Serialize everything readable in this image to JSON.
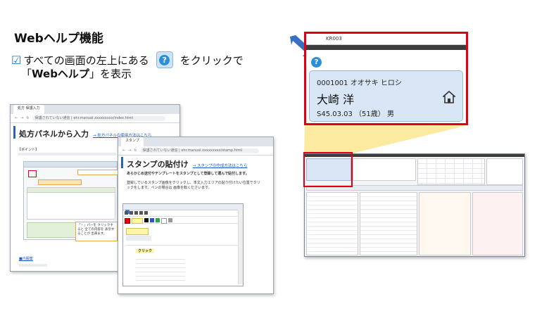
{
  "heading": "Webヘルプ機能",
  "instruction": {
    "checkbox_glyph": "☑",
    "before_icon": "すべての画面の左上にある",
    "help_icon": "question-circle-icon",
    "after_icon": "をクリックで",
    "line2_open": "「",
    "line2_bold": "Webヘルプ",
    "line2_close": "」を表示"
  },
  "browser_back": {
    "tab_label": "処方 保護入力",
    "address": "保護されていない通信 | ehr.manual.xxxxxxxxx/index.html",
    "page_title": "処方パネルから入力",
    "page_link": "→ 処方パネルの使用方法はこちら",
    "point_label": "【ポイント】",
    "callout_text": "「・」パーを クリックすると 全ての内容を 表示することが 出来ます。",
    "footer_link": "■内服薬"
  },
  "browser_front": {
    "tab_label": "スタンプ",
    "address": "保護されていない通信 | ehr.manual.xxxxxxxxx/stamp.html",
    "page_title": "スタンプの貼付け",
    "page_link": "→ スタンプの作成方法はこちら",
    "subtitle": "あらかじめ送付やテンプレートをスタンプとして登録して選んで貼付します。",
    "body_text": "登録しているスタンプ画像をクリックし、本文入力エリアの貼り付けたい位置でクリックをします。ペンの場合は 画像を転くださいます。",
    "click_label": "クリック"
  },
  "zoom_panel": {
    "header_label": "KR003",
    "help_icon": "question-circle-icon",
    "patient_id_kana": "0001001 オオサキ ヒロシ",
    "patient_name": "大崎 洋",
    "patient_dob": "S45.03.03 （51歳） 男",
    "patient_icon": "home-icon"
  },
  "colors": {
    "highlight_red": "#e00016",
    "arrow_blue": "#3a6fc4",
    "funnel_yellow": "#fbeaa0",
    "card_blue": "#d9e6f5"
  }
}
